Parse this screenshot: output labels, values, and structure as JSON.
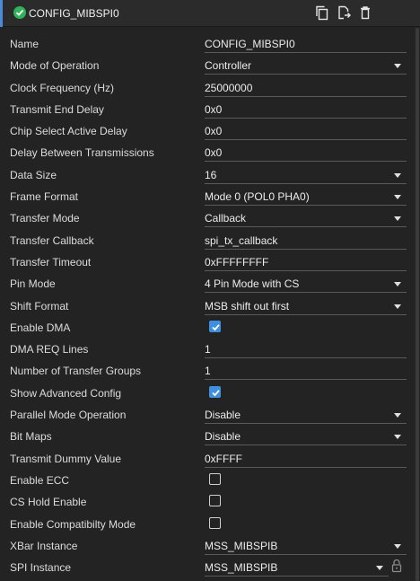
{
  "header": {
    "title": "CONFIG_MIBSPI0",
    "status_icon": "check-circle-icon",
    "actions": [
      "copy-icon",
      "export-icon",
      "delete-icon"
    ]
  },
  "rows": [
    {
      "label": "Name",
      "type": "text",
      "value": "CONFIG_MIBSPI0"
    },
    {
      "label": "Mode of Operation",
      "type": "select",
      "value": "Controller"
    },
    {
      "label": "Clock Frequency (Hz)",
      "type": "text",
      "value": "25000000"
    },
    {
      "label": "Transmit End Delay",
      "type": "text",
      "value": "0x0"
    },
    {
      "label": "Chip Select Active Delay",
      "type": "text",
      "value": "0x0"
    },
    {
      "label": "Delay Between Transmissions",
      "type": "text",
      "value": "0x0"
    },
    {
      "label": "Data Size",
      "type": "select",
      "value": "16"
    },
    {
      "label": "Frame Format",
      "type": "select",
      "value": "Mode 0 (POL0 PHA0)"
    },
    {
      "label": "Transfer Mode",
      "type": "select",
      "value": "Callback"
    },
    {
      "label": "Transfer Callback",
      "type": "text",
      "value": "spi_tx_callback"
    },
    {
      "label": "Transfer Timeout",
      "type": "text",
      "value": "0xFFFFFFFF"
    },
    {
      "label": "Pin Mode",
      "type": "select",
      "value": "4 Pin Mode with CS"
    },
    {
      "label": "Shift Format",
      "type": "select",
      "value": "MSB shift out first"
    },
    {
      "label": "Enable DMA",
      "type": "checkbox",
      "checked": true
    },
    {
      "label": "DMA REQ Lines",
      "type": "text",
      "value": "1"
    },
    {
      "label": "Number of Transfer Groups",
      "type": "text",
      "value": "1"
    },
    {
      "label": "Show Advanced Config",
      "type": "checkbox",
      "checked": true
    },
    {
      "label": "Parallel Mode Operation",
      "type": "select",
      "value": "Disable"
    },
    {
      "label": "Bit Maps",
      "type": "select",
      "value": "Disable"
    },
    {
      "label": "Transmit Dummy Value",
      "type": "text",
      "value": "0xFFFF"
    },
    {
      "label": "Enable ECC",
      "type": "checkbox",
      "checked": false
    },
    {
      "label": "CS Hold Enable",
      "type": "checkbox",
      "checked": false
    },
    {
      "label": "Enable Compatibilty Mode",
      "type": "checkbox",
      "checked": false
    },
    {
      "label": "XBar Instance",
      "type": "select",
      "value": "MSS_MIBSPIB"
    },
    {
      "label": "SPI Instance",
      "type": "select",
      "value": "MSS_MIBSPIB",
      "locked": true
    }
  ],
  "colors": {
    "background": "#232323",
    "accent": "#4a8ad8",
    "status_ok": "#2fb45a",
    "checkbox_on": "#3f8fe0"
  }
}
